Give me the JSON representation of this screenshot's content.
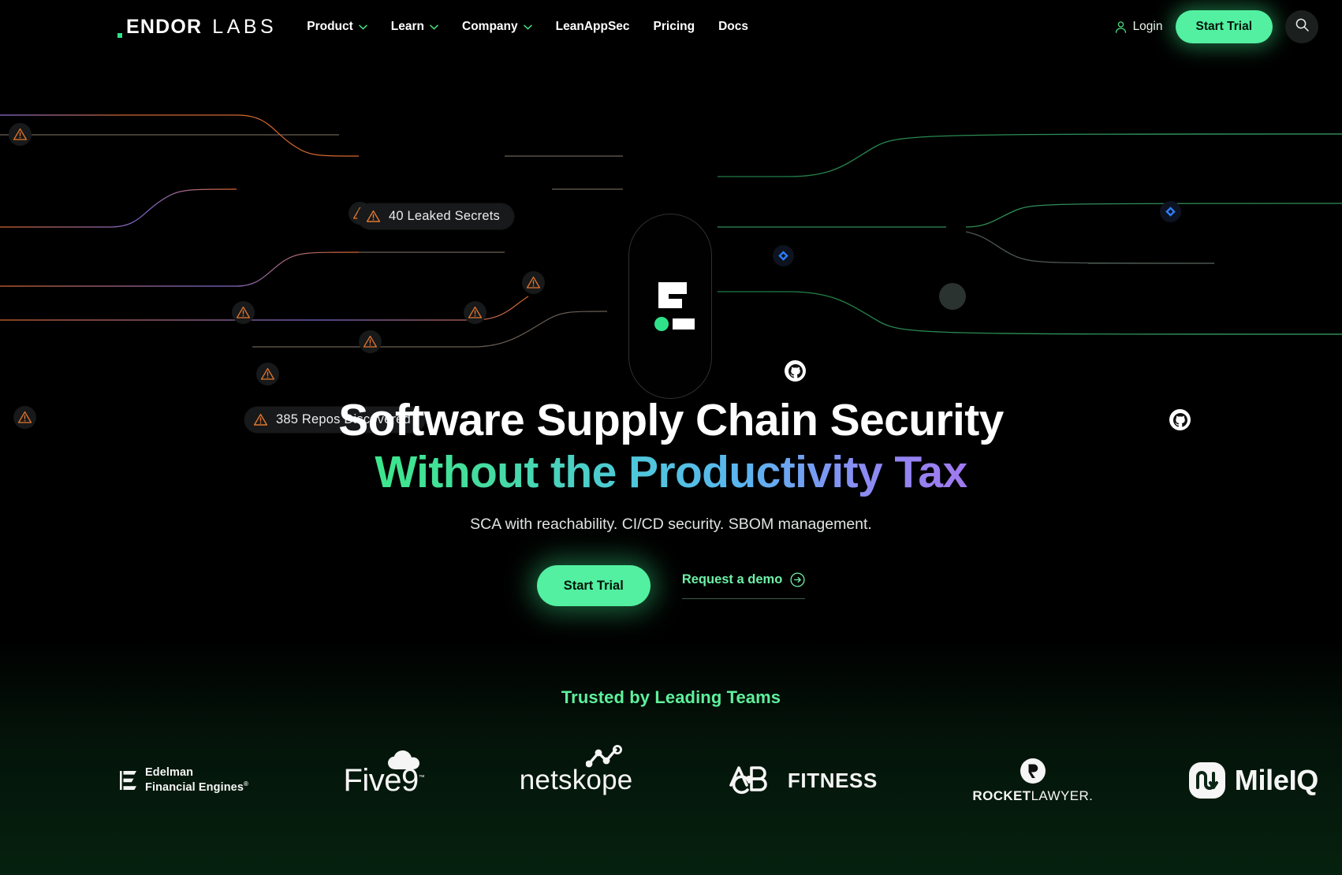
{
  "brand": {
    "logo_endor": "ENDOR",
    "logo_labs": "LABS",
    "accent_green": "#52f0a0",
    "logo_dot_color": "#2fe28a"
  },
  "header": {
    "nav": [
      {
        "label": "Product",
        "has_dropdown": true
      },
      {
        "label": "Learn",
        "has_dropdown": true
      },
      {
        "label": "Company",
        "has_dropdown": true
      },
      {
        "label": "LeanAppSec",
        "has_dropdown": false
      },
      {
        "label": "Pricing",
        "has_dropdown": false
      },
      {
        "label": "Docs",
        "has_dropdown": false
      }
    ],
    "login_label": "Login",
    "start_trial_label": "Start Trial",
    "search_icon": "search-icon"
  },
  "graphic": {
    "labels": [
      {
        "text": "40 Leaked Secrets",
        "icon": "warning-triangle-icon"
      },
      {
        "text": "385 Repos Discovered",
        "icon": "warning-triangle-icon"
      }
    ],
    "node_icons": [
      "warning-triangle-icon",
      "diamond-icon",
      "github-icon",
      "hub-node"
    ],
    "line_alert_color": "#e0703c",
    "line_ok_color": "#2f8f58"
  },
  "hero": {
    "headline_line1": "Software Supply Chain Security",
    "headline_line2": "Without the Productivity Tax",
    "subheadline": "SCA with reachability. CI/CD security. SBOM management.",
    "primary_cta": "Start Trial",
    "secondary_cta": "Request a demo",
    "gradient_start": "#3ce78c",
    "gradient_mid": "#4ec9d8",
    "gradient_end": "#a179f0"
  },
  "trusted": {
    "title": "Trusted by Leading Teams",
    "title_color": "#5ef09c",
    "clients": [
      {
        "name": "Edelman Financial Engines",
        "line1": "Edelman",
        "line2": "Financial Engines",
        "sup": "®"
      },
      {
        "name": "Five9",
        "text": "Five9",
        "sup": "™"
      },
      {
        "name": "netskope",
        "text": "netskope"
      },
      {
        "name": "ABC Fitness",
        "text": "FITNESS"
      },
      {
        "name": "Rocket Lawyer",
        "bold": "ROCKET",
        "light": "LAWYER."
      },
      {
        "name": "MileIQ",
        "text": "MileIQ"
      }
    ]
  }
}
